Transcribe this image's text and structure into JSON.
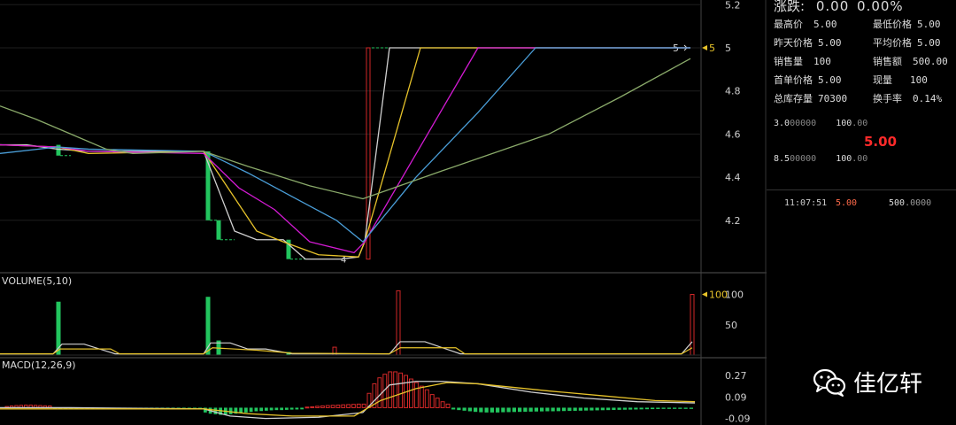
{
  "header": {
    "change_label": "涨跌:",
    "change_value": "0.00",
    "change_pct": "0.00%"
  },
  "stats": [
    {
      "label": "最高价",
      "value": "5.00"
    },
    {
      "label": "最低价格",
      "value": "5.00"
    },
    {
      "label": "昨天价格",
      "value": "5.00"
    },
    {
      "label": "平均价格",
      "value": "5.00"
    },
    {
      "label": "销售量",
      "value": "100"
    },
    {
      "label": "销售额",
      "value": "500.00"
    },
    {
      "label": "首单价格",
      "value": "5.00"
    },
    {
      "label": "现量",
      "value": "100"
    },
    {
      "label": "总库存量",
      "value": "70300"
    },
    {
      "label": "换手率",
      "value": "0.14%"
    }
  ],
  "order_book": {
    "ask": {
      "price": "3.0",
      "price_tail": "00000",
      "qty": "100",
      "qty_tail": ".00"
    },
    "last_price": "5.00",
    "bid": {
      "price": "8.5",
      "price_tail": "00000",
      "qty": "100",
      "qty_tail": ".00"
    }
  },
  "trade": {
    "time": "11:07:51",
    "price": "5.00",
    "amount": "500",
    "amount_tail": ".0000"
  },
  "watermark": {
    "text": "佳亿轩"
  },
  "colors": {
    "up": "#d22828",
    "down": "#22c55e",
    "ma_white": "#d0d0d0",
    "ma_yellow": "#e6c22a",
    "ma_magenta": "#d21ad2",
    "ma_blue": "#4a9ed8",
    "ma_green": "#8aaa6a",
    "price_marker": "#e6c22a"
  },
  "chart_data": [
    {
      "type": "line",
      "panel": "price",
      "ylim": [
        4.0,
        5.2
      ],
      "y_ticks": [
        "5.2",
        "5",
        "4.8",
        "4.6",
        "4.4",
        "4.2"
      ],
      "current_marker": "5",
      "price_line_label": "5",
      "low_label": "4",
      "series": [
        {
          "color": "white",
          "points": [
            [
              0,
              4.55
            ],
            [
              30,
              4.55
            ],
            [
              65,
              4.53
            ],
            [
              100,
              4.52
            ],
            [
              230,
              4.52
            ],
            [
              265,
              4.15
            ],
            [
              290,
              4.11
            ],
            [
              320,
              4.11
            ],
            [
              345,
              4.02
            ],
            [
              385,
              4.02
            ],
            [
              405,
              4.03
            ],
            [
              412,
              4.1
            ],
            [
              440,
              5.0
            ],
            [
              780,
              5.0
            ]
          ]
        },
        {
          "color": "yellow",
          "points": [
            [
              0,
              4.55
            ],
            [
              65,
              4.54
            ],
            [
              100,
              4.51
            ],
            [
              230,
              4.52
            ],
            [
              290,
              4.15
            ],
            [
              320,
              4.1
            ],
            [
              360,
              4.04
            ],
            [
              405,
              4.03
            ],
            [
              412,
              4.1
            ],
            [
              475,
              5.0
            ],
            [
              780,
              5.0
            ]
          ]
        },
        {
          "color": "magenta",
          "points": [
            [
              0,
              4.55
            ],
            [
              65,
              4.54
            ],
            [
              100,
              4.52
            ],
            [
              230,
              4.51
            ],
            [
              270,
              4.35
            ],
            [
              310,
              4.25
            ],
            [
              350,
              4.1
            ],
            [
              400,
              4.05
            ],
            [
              412,
              4.1
            ],
            [
              540,
              5.0
            ],
            [
              780,
              5.0
            ]
          ]
        },
        {
          "color": "blue",
          "points": [
            [
              0,
              4.51
            ],
            [
              65,
              4.54
            ],
            [
              100,
              4.53
            ],
            [
              230,
              4.52
            ],
            [
              280,
              4.42
            ],
            [
              330,
              4.31
            ],
            [
              380,
              4.2
            ],
            [
              410,
              4.1
            ],
            [
              470,
              4.4
            ],
            [
              540,
              4.7
            ],
            [
              605,
              5.0
            ],
            [
              780,
              5.0
            ]
          ]
        },
        {
          "color": "green",
          "points": [
            [
              0,
              4.73
            ],
            [
              40,
              4.67
            ],
            [
              80,
              4.6
            ],
            [
              120,
              4.53
            ],
            [
              150,
              4.51
            ],
            [
              230,
              4.52
            ],
            [
              280,
              4.45
            ],
            [
              350,
              4.36
            ],
            [
              410,
              4.3
            ],
            [
              500,
              4.43
            ],
            [
              620,
              4.6
            ],
            [
              700,
              4.77
            ],
            [
              780,
              4.95
            ]
          ]
        }
      ],
      "bars": [
        {
          "x": 66,
          "y0": 4.55,
          "y1": 4.5,
          "color": "down"
        },
        {
          "x": 235,
          "y0": 4.52,
          "y1": 4.2,
          "color": "down"
        },
        {
          "x": 247,
          "y0": 4.2,
          "y1": 4.11,
          "color": "down"
        },
        {
          "x": 326,
          "y0": 4.11,
          "y1": 4.02,
          "color": "down"
        },
        {
          "x": 416,
          "y0": 4.02,
          "y1": 5.0,
          "color": "up"
        }
      ],
      "steps": [
        {
          "x0": 68,
          "x1": 80,
          "y": 4.5
        },
        {
          "x0": 237,
          "x1": 245,
          "y": 4.2
        },
        {
          "x0": 249,
          "x1": 265,
          "y": 4.11
        },
        {
          "x0": 328,
          "x1": 345,
          "y": 4.02
        },
        {
          "x0": 420,
          "x1": 440,
          "y": 5.0
        }
      ]
    },
    {
      "type": "bar",
      "panel": "volume",
      "title": "VOLUME(5,10)",
      "ylim": [
        0,
        115
      ],
      "y_ticks": [
        "100",
        "50"
      ],
      "current_marker": "100",
      "bars": [
        {
          "x": 66,
          "value": 88,
          "color": "down",
          "style": "solid"
        },
        {
          "x": 235,
          "value": 96,
          "color": "down",
          "style": "solid"
        },
        {
          "x": 247,
          "value": 24,
          "color": "down",
          "style": "solid"
        },
        {
          "x": 326,
          "value": 5,
          "color": "down",
          "style": "solid"
        },
        {
          "x": 378,
          "value": 13,
          "color": "up",
          "style": "hollow"
        },
        {
          "x": 450,
          "value": 106,
          "color": "up",
          "style": "hollow"
        },
        {
          "x": 782,
          "value": 100,
          "color": "up",
          "style": "hollow"
        }
      ],
      "series": [
        {
          "color": "white",
          "points": [
            [
              0,
              2
            ],
            [
              60,
              2
            ],
            [
              70,
              18
            ],
            [
              95,
              18
            ],
            [
              130,
              2
            ],
            [
              230,
              2
            ],
            [
              238,
              20
            ],
            [
              260,
              20
            ],
            [
              280,
              10
            ],
            [
              300,
              10
            ],
            [
              330,
              2
            ],
            [
              440,
              2
            ],
            [
              452,
              22
            ],
            [
              480,
              22
            ],
            [
              520,
              2
            ],
            [
              770,
              2
            ],
            [
              782,
              22
            ]
          ]
        },
        {
          "color": "yellow",
          "points": [
            [
              0,
              2
            ],
            [
              60,
              2
            ],
            [
              68,
              10
            ],
            [
              125,
              10
            ],
            [
              135,
              2
            ],
            [
              230,
              2
            ],
            [
              240,
              12
            ],
            [
              290,
              8
            ],
            [
              330,
              3
            ],
            [
              440,
              2
            ],
            [
              452,
              12
            ],
            [
              515,
              12
            ],
            [
              525,
              2
            ],
            [
              770,
              2
            ],
            [
              782,
              12
            ]
          ]
        }
      ]
    },
    {
      "type": "bar",
      "panel": "macd",
      "title": "MACD(12,26,9)",
      "ylim": [
        -0.11,
        0.33
      ],
      "y_ticks": [
        "0.27",
        "0.09",
        "-0.09"
      ],
      "histogram_bar_count": 130,
      "histogram": [
        {
          "x0": 6,
          "x1": 60,
          "values": [
            0.01,
            0.015,
            0.018,
            0.02,
            0.022,
            0.022,
            0.02,
            0.018,
            0.016,
            0.015
          ]
        },
        {
          "x0": 60,
          "x1": 230,
          "values": [
            -0.01,
            -0.012,
            -0.014,
            -0.014,
            -0.013,
            -0.012,
            -0.012,
            -0.011,
            -0.011,
            -0.01,
            -0.01,
            -0.01,
            -0.01,
            -0.009,
            -0.009,
            -0.008,
            -0.008,
            -0.007,
            -0.006,
            -0.005,
            -0.004,
            -0.003,
            -0.003,
            -0.002,
            -0.002,
            -0.002,
            -0.001,
            -0.001
          ]
        },
        {
          "x0": 230,
          "x1": 345,
          "values": [
            -0.04,
            -0.05,
            -0.055,
            -0.06,
            -0.058,
            -0.055,
            -0.05,
            -0.045,
            -0.04,
            -0.035,
            -0.03,
            -0.028,
            -0.025,
            -0.022,
            -0.02,
            -0.02,
            -0.018,
            -0.016,
            -0.015,
            -0.014
          ]
        },
        {
          "x0": 345,
          "x1": 415,
          "values": [
            0.005,
            0.008,
            0.012,
            0.015,
            0.018,
            0.02,
            0.022,
            0.024,
            0.026,
            0.028,
            0.03,
            0.03
          ]
        },
        {
          "x0": 415,
          "x1": 510,
          "values": [
            0.12,
            0.2,
            0.25,
            0.28,
            0.3,
            0.3,
            0.29,
            0.27,
            0.24,
            0.21,
            0.18,
            0.15,
            0.11,
            0.08,
            0.05,
            0.03
          ]
        },
        {
          "x0": 510,
          "x1": 785,
          "values": [
            -0.015,
            -0.02,
            -0.025,
            -0.03,
            -0.035,
            -0.038,
            -0.04,
            -0.04,
            -0.04,
            -0.038,
            -0.037,
            -0.036,
            -0.035,
            -0.034,
            -0.033,
            -0.032,
            -0.031,
            -0.03,
            -0.03,
            -0.029,
            -0.028,
            -0.027,
            -0.026,
            -0.025,
            -0.024,
            -0.023,
            -0.022,
            -0.021,
            -0.02,
            -0.019,
            -0.018,
            -0.017,
            -0.016,
            -0.015,
            -0.014,
            -0.013,
            -0.012,
            -0.011,
            -0.01,
            -0.01,
            -0.01,
            -0.01,
            -0.01,
            -0.01
          ]
        }
      ],
      "series": [
        {
          "color": "white",
          "points": [
            [
              0,
              0.0
            ],
            [
              80,
              0.0
            ],
            [
              230,
              -0.01
            ],
            [
              260,
              -0.07
            ],
            [
              300,
              -0.09
            ],
            [
              360,
              -0.08
            ],
            [
              410,
              -0.04
            ],
            [
              440,
              0.19
            ],
            [
              470,
              0.22
            ],
            [
              500,
              0.22
            ],
            [
              540,
              0.2
            ],
            [
              600,
              0.13
            ],
            [
              660,
              0.08
            ],
            [
              720,
              0.05
            ],
            [
              785,
              0.04
            ]
          ]
        },
        {
          "color": "yellow",
          "points": [
            [
              0,
              -0.01
            ],
            [
              80,
              -0.01
            ],
            [
              230,
              -0.01
            ],
            [
              280,
              -0.05
            ],
            [
              330,
              -0.07
            ],
            [
              400,
              -0.07
            ],
            [
              430,
              0.06
            ],
            [
              470,
              0.16
            ],
            [
              505,
              0.21
            ],
            [
              540,
              0.2
            ],
            [
              620,
              0.14
            ],
            [
              680,
              0.1
            ],
            [
              740,
              0.06
            ],
            [
              785,
              0.05
            ]
          ]
        }
      ]
    }
  ]
}
